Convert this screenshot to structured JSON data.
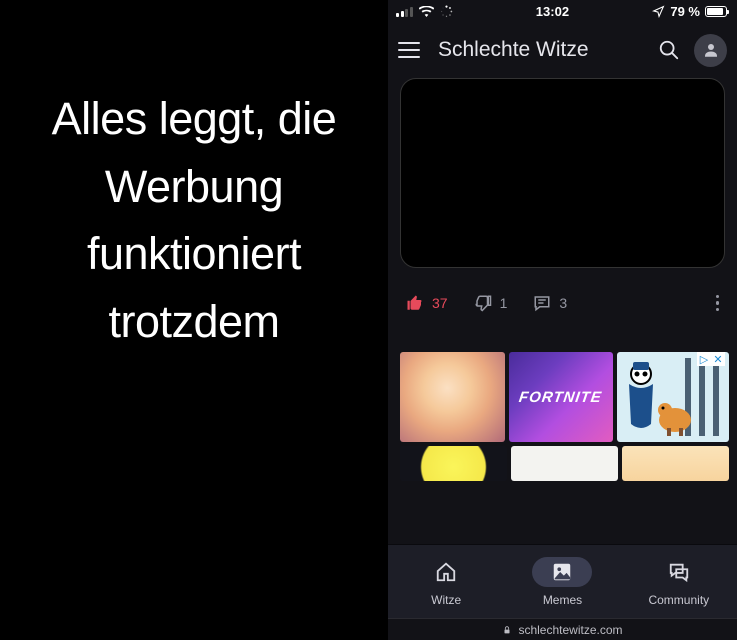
{
  "left": {
    "text": "Alles leggt, die Werbung funktioniert trotzdem"
  },
  "status": {
    "time": "13:02",
    "battery_pct": "79 %"
  },
  "header": {
    "title": "Schlechte Witze"
  },
  "post": {
    "likes": "37",
    "dislikes": "1",
    "comments": "3"
  },
  "ad": {
    "thumb2_label": "FORTNITE"
  },
  "nav": {
    "item1": "Witze",
    "item2": "Memes",
    "item3": "Community"
  },
  "url": "schlechtewitze.com"
}
